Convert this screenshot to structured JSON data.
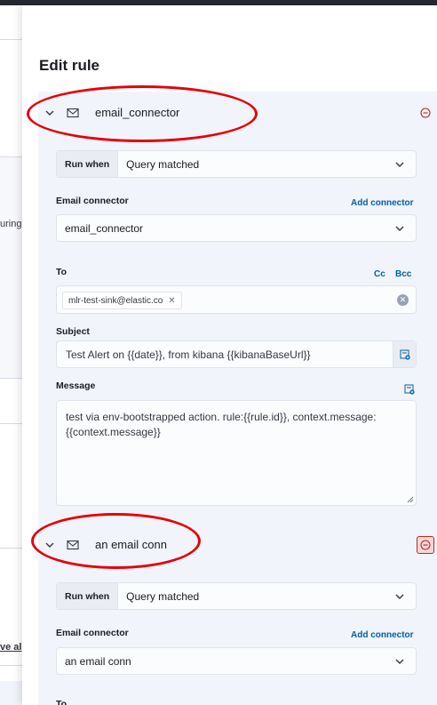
{
  "flyout": {
    "title": "Edit rule"
  },
  "background": {
    "fragment_1": "uring",
    "fragment_2": "ve al"
  },
  "actions": [
    {
      "connector_name": "email_connector",
      "run_when_label": "Run when",
      "run_when_value": "Query matched",
      "email_connector_label": "Email connector",
      "add_connector_link": "Add connector",
      "email_connector_value": "email_connector",
      "to_label": "To",
      "cc_link": "Cc",
      "bcc_link": "Bcc",
      "to_recipient": "mlr-test-sink@elastic.co",
      "subject_label": "Subject",
      "subject_value": "Test Alert on {{date}}, from kibana {{kibanaBaseUrl}}",
      "message_label": "Message",
      "message_value": "test via env-bootstrapped action. rule:{{rule.id}}, context.message: {{context.message}}"
    },
    {
      "connector_name": "an email conn",
      "run_when_label": "Run when",
      "run_when_value": "Query matched",
      "email_connector_label": "Email connector",
      "add_connector_link": "Add connector",
      "email_connector_value": "an email conn",
      "to_label": "To"
    }
  ],
  "colors": {
    "accent": "#0061a6",
    "danger": "#bd271e",
    "annotation": "#e5000a",
    "panel": "#f1f4fa"
  }
}
